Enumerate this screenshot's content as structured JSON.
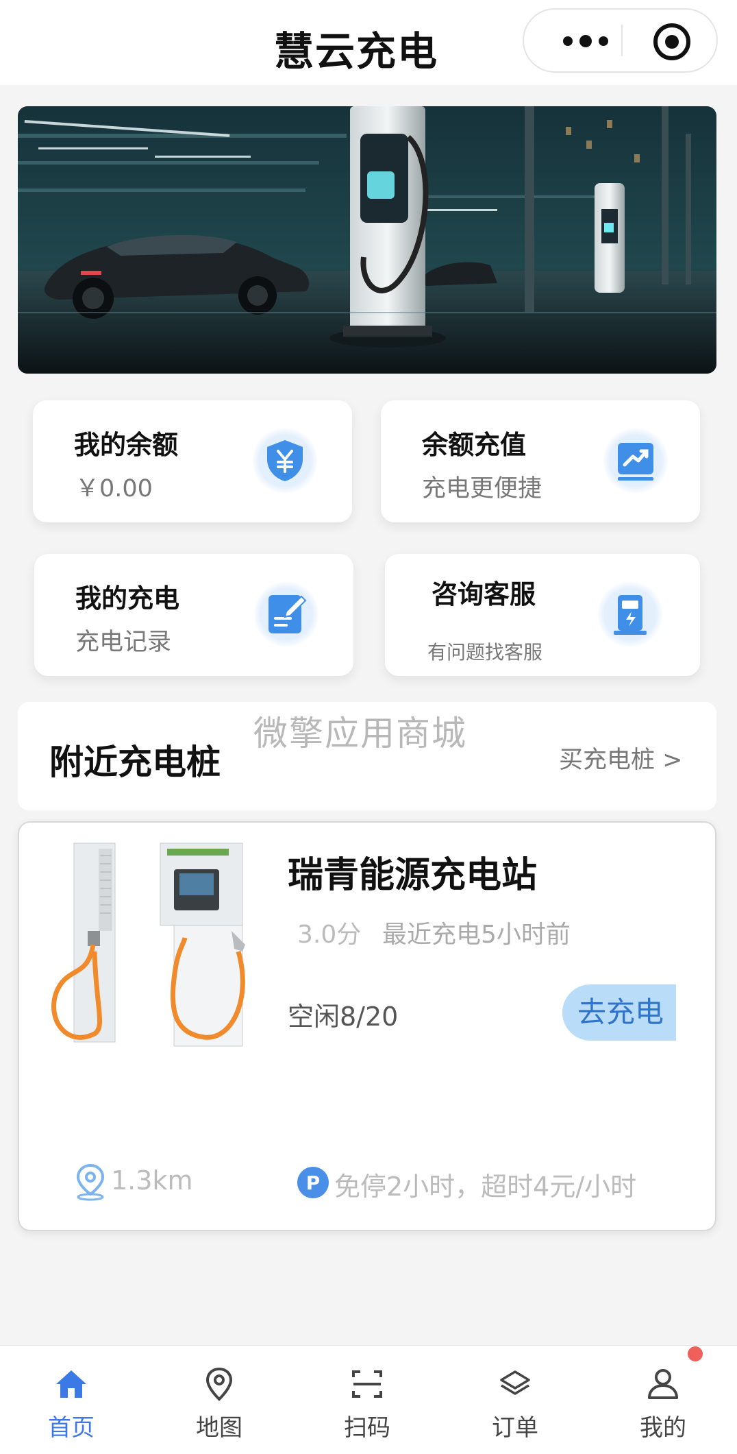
{
  "header": {
    "title": "慧云充电"
  },
  "capsule": {
    "more_icon": "more-dots-icon",
    "close_icon": "target-circle-icon"
  },
  "banner": {
    "image": "ev-charging-station-photo"
  },
  "cards": [
    {
      "title": "我的余额",
      "subtitle": "￥0.00",
      "icon": "yuan-shield-icon"
    },
    {
      "title": "余额充值",
      "subtitle": "充电更便捷",
      "icon": "chart-up-icon"
    },
    {
      "title": "我的充电",
      "subtitle": "充电记录",
      "icon": "edit-note-icon"
    },
    {
      "title": "咨询客服",
      "subtitle": "有问题找客服",
      "icon": "charger-pile-icon"
    }
  ],
  "watermark": "微擎应用商城",
  "nearby": {
    "title": "附近充电桩",
    "link": "买充电桩 >"
  },
  "station": {
    "name": "瑞青能源充电站",
    "rating": "3.0分",
    "last_charge": "最近充电5小时前",
    "free": "空闲8/20",
    "button": "去充电",
    "distance": "1.3km",
    "parking": "免停2小时，超时4元/小时"
  },
  "tabbar": [
    {
      "label": "首页",
      "icon": "home-icon",
      "active": true
    },
    {
      "label": "地图",
      "icon": "map-pin-icon",
      "active": false
    },
    {
      "label": "扫码",
      "icon": "scan-icon",
      "active": false
    },
    {
      "label": "订单",
      "icon": "layers-icon",
      "active": false
    },
    {
      "label": "我的",
      "icon": "user-icon",
      "active": false
    }
  ],
  "colors": {
    "accent": "#3b7ae6",
    "button_bg": "#b9dcf9",
    "badge": "#f0605a"
  }
}
